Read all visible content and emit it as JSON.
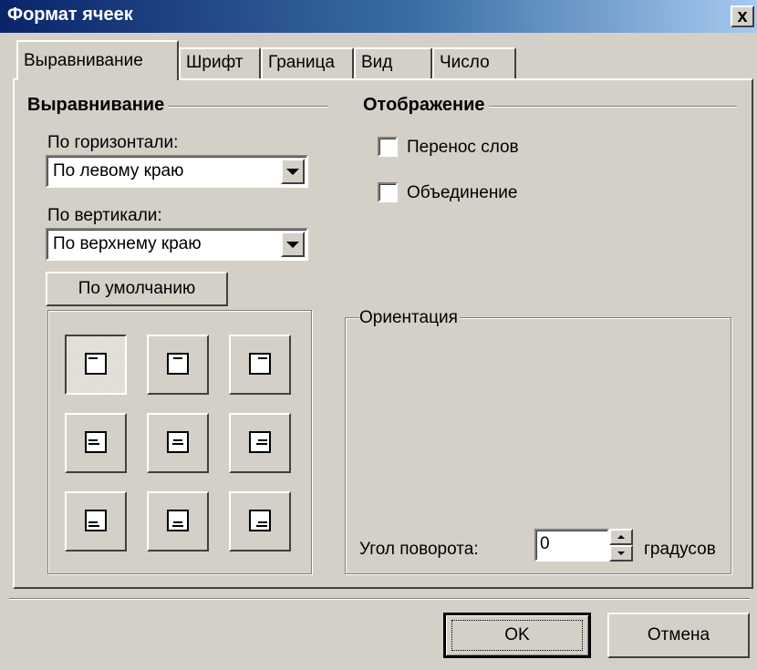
{
  "window": {
    "title": "Формат ячеек",
    "close_glyph": "x"
  },
  "tabs": [
    "Выравнивание",
    "Шрифт",
    "Граница",
    "Вид",
    "Число"
  ],
  "alignment": {
    "heading": "Выравнивание",
    "horizontal_label": "По горизонтали:",
    "horizontal_value": "По левому краю",
    "vertical_label": "По вертикали:",
    "vertical_value": "По верхнему краю",
    "default_button": "По умолчанию"
  },
  "display": {
    "heading": "Отображение",
    "wrap_label": "Перенос слов",
    "wrap_checked": false,
    "merge_label": "Объединение",
    "merge_checked": false
  },
  "orientation": {
    "heading": "Ориентация",
    "angle_label": "Угол поворота:",
    "angle_value": "0",
    "angle_units": "градусов"
  },
  "footer": {
    "ok": "OK",
    "cancel": "Отмена"
  },
  "grid": {
    "selected": "top-left"
  }
}
